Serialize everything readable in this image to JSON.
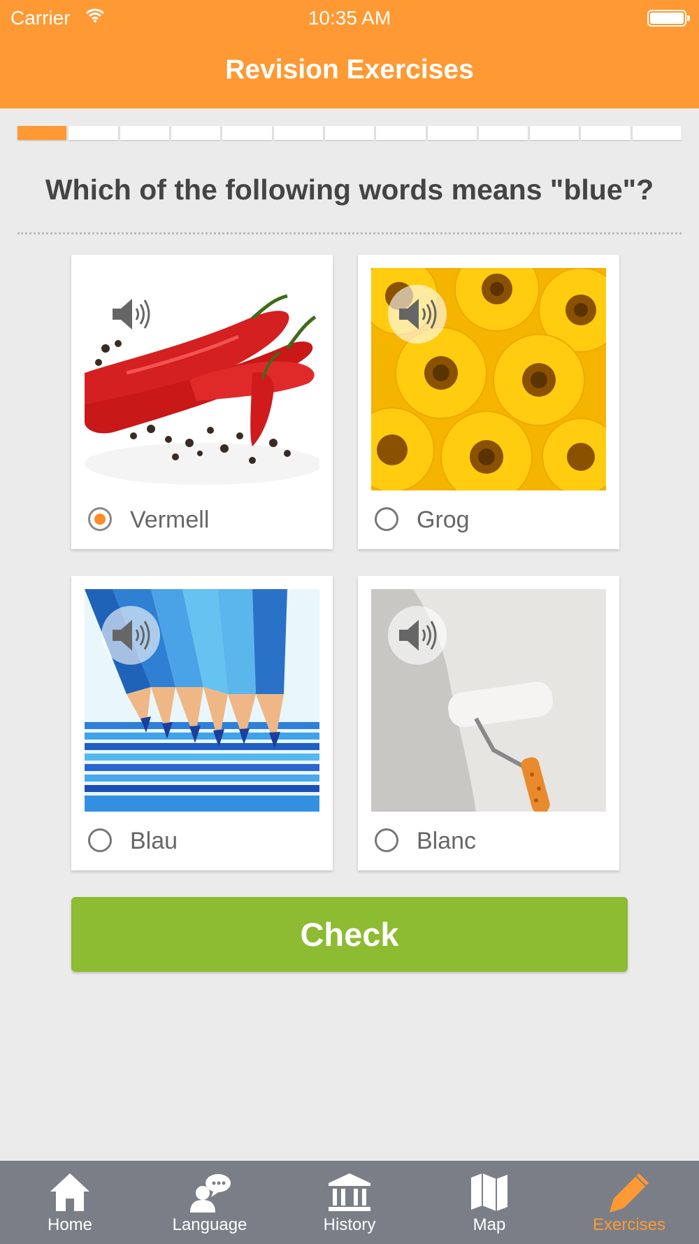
{
  "status_bar": {
    "carrier": "Carrier",
    "time": "10:35 AM",
    "wifi_icon": "wifi-icon",
    "battery_icon": "battery-icon"
  },
  "header": {
    "title": "Revision Exercises"
  },
  "progress": {
    "total_steps": 13,
    "current_step": 1
  },
  "question": {
    "text": "Which of the following words means \"blue\"?"
  },
  "options": [
    {
      "label": "Vermell",
      "image": "red-chili-peppers",
      "selected": true
    },
    {
      "label": "Grog",
      "image": "yellow-sunflowers",
      "selected": false
    },
    {
      "label": "Blau",
      "image": "blue-colored-pencils",
      "selected": false
    },
    {
      "label": "Blanc",
      "image": "white-paint-roller-wall",
      "selected": false
    }
  ],
  "check_button": {
    "label": "Check"
  },
  "tabs": [
    {
      "label": "Home",
      "icon": "home-icon",
      "active": false
    },
    {
      "label": "Language",
      "icon": "language-icon",
      "active": false
    },
    {
      "label": "History",
      "icon": "history-icon",
      "active": false
    },
    {
      "label": "Map",
      "icon": "map-icon",
      "active": false
    },
    {
      "label": "Exercises",
      "icon": "pencil-icon",
      "active": true
    }
  ],
  "colors": {
    "accent": "#ff9933",
    "check_button": "#8dbb31",
    "tabbar": "#7a7f87"
  }
}
